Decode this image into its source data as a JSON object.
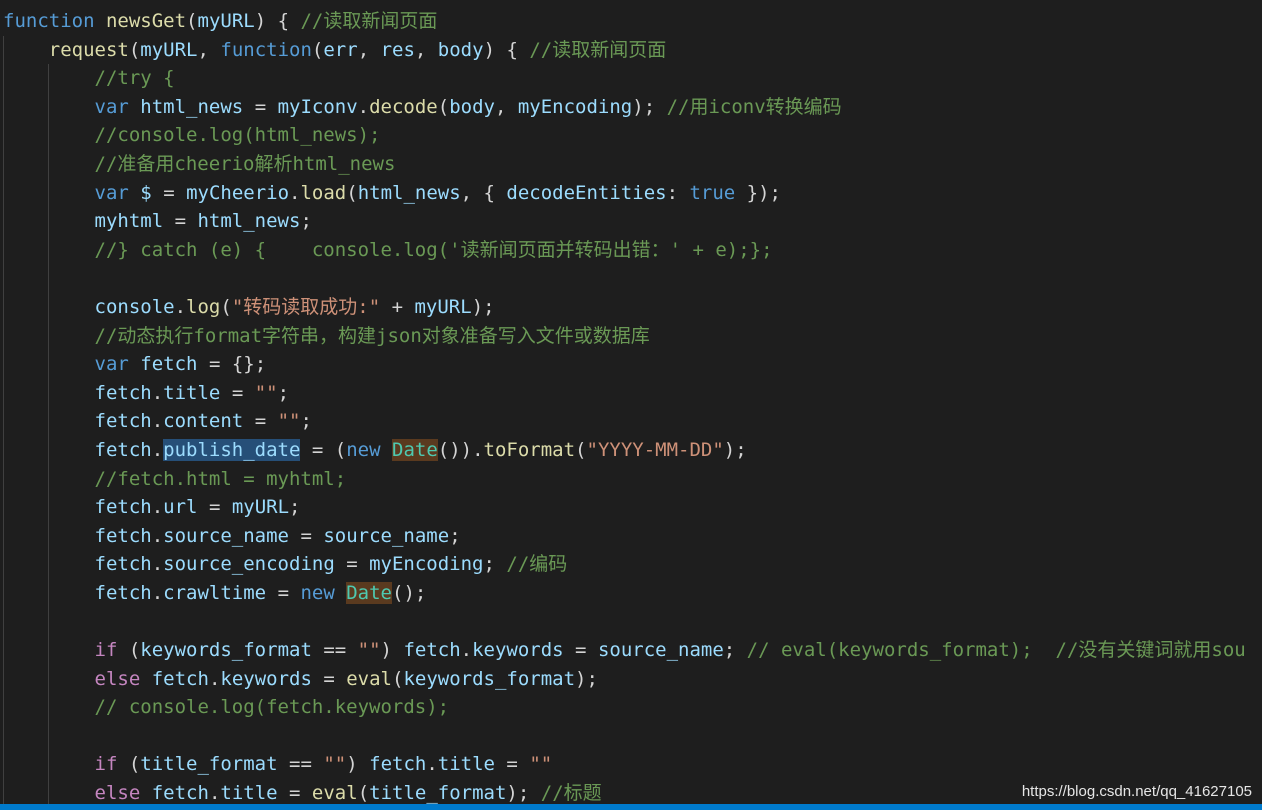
{
  "editor": {
    "lines": [
      [
        [
          "kw",
          "function"
        ],
        [
          "punc",
          " "
        ],
        [
          "fn",
          "newsGet"
        ],
        [
          "punc",
          "("
        ],
        [
          "var",
          "myURL"
        ],
        [
          "punc",
          ") { "
        ],
        [
          "cmt",
          "//读取新闻页面"
        ]
      ],
      [
        [
          "punc",
          "    "
        ],
        [
          "fn",
          "request"
        ],
        [
          "punc",
          "("
        ],
        [
          "var",
          "myURL"
        ],
        [
          "punc",
          ", "
        ],
        [
          "kw",
          "function"
        ],
        [
          "punc",
          "("
        ],
        [
          "var",
          "err"
        ],
        [
          "punc",
          ", "
        ],
        [
          "var",
          "res"
        ],
        [
          "punc",
          ", "
        ],
        [
          "var",
          "body"
        ],
        [
          "punc",
          ") { "
        ],
        [
          "cmt",
          "//读取新闻页面"
        ]
      ],
      [
        [
          "punc",
          "        "
        ],
        [
          "cmt",
          "//try {"
        ]
      ],
      [
        [
          "punc",
          "        "
        ],
        [
          "kw",
          "var"
        ],
        [
          "punc",
          " "
        ],
        [
          "var",
          "html_news"
        ],
        [
          "punc",
          " = "
        ],
        [
          "var",
          "myIconv"
        ],
        [
          "punc",
          "."
        ],
        [
          "fn",
          "decode"
        ],
        [
          "punc",
          "("
        ],
        [
          "var",
          "body"
        ],
        [
          "punc",
          ", "
        ],
        [
          "var",
          "myEncoding"
        ],
        [
          "punc",
          "); "
        ],
        [
          "cmt",
          "//用iconv转换编码"
        ]
      ],
      [
        [
          "punc",
          "        "
        ],
        [
          "cmt",
          "//console.log(html_news);"
        ]
      ],
      [
        [
          "punc",
          "        "
        ],
        [
          "cmt",
          "//准备用cheerio解析html_news"
        ]
      ],
      [
        [
          "punc",
          "        "
        ],
        [
          "kw",
          "var"
        ],
        [
          "punc",
          " "
        ],
        [
          "var",
          "$"
        ],
        [
          "punc",
          " = "
        ],
        [
          "var",
          "myCheerio"
        ],
        [
          "punc",
          "."
        ],
        [
          "fn",
          "load"
        ],
        [
          "punc",
          "("
        ],
        [
          "var",
          "html_news"
        ],
        [
          "punc",
          ", { "
        ],
        [
          "var",
          "decodeEntities"
        ],
        [
          "punc",
          ": "
        ],
        [
          "kw",
          "true"
        ],
        [
          "punc",
          " });"
        ]
      ],
      [
        [
          "punc",
          "        "
        ],
        [
          "var",
          "myhtml"
        ],
        [
          "punc",
          " = "
        ],
        [
          "var",
          "html_news"
        ],
        [
          "punc",
          ";"
        ]
      ],
      [
        [
          "punc",
          "        "
        ],
        [
          "cmt",
          "//} catch (e) {    console.log('读新闻页面并转码出错：' + e);};"
        ]
      ],
      [
        [
          "punc",
          " "
        ]
      ],
      [
        [
          "punc",
          "        "
        ],
        [
          "var",
          "console"
        ],
        [
          "punc",
          "."
        ],
        [
          "fn",
          "log"
        ],
        [
          "punc",
          "("
        ],
        [
          "str",
          "\"转码读取成功:\""
        ],
        [
          "punc",
          " + "
        ],
        [
          "var",
          "myURL"
        ],
        [
          "punc",
          ");"
        ]
      ],
      [
        [
          "punc",
          "        "
        ],
        [
          "cmt",
          "//动态执行format字符串，构建json对象准备写入文件或数据库"
        ]
      ],
      [
        [
          "punc",
          "        "
        ],
        [
          "kw",
          "var"
        ],
        [
          "punc",
          " "
        ],
        [
          "var",
          "fetch"
        ],
        [
          "punc",
          " = {};"
        ]
      ],
      [
        [
          "punc",
          "        "
        ],
        [
          "var",
          "fetch"
        ],
        [
          "punc",
          "."
        ],
        [
          "var",
          "title"
        ],
        [
          "punc",
          " = "
        ],
        [
          "str",
          "\"\""
        ],
        [
          "punc",
          ";"
        ]
      ],
      [
        [
          "punc",
          "        "
        ],
        [
          "var",
          "fetch"
        ],
        [
          "punc",
          "."
        ],
        [
          "var",
          "content"
        ],
        [
          "punc",
          " = "
        ],
        [
          "str",
          "\"\""
        ],
        [
          "punc",
          ";"
        ]
      ],
      [
        [
          "punc",
          "        "
        ],
        [
          "var",
          "fetch"
        ],
        [
          "punc",
          "."
        ],
        [
          "hl",
          "publish_date"
        ],
        [
          "punc",
          " = ("
        ],
        [
          "kw",
          "new"
        ],
        [
          "punc",
          " "
        ],
        [
          "bhl",
          "Date"
        ],
        [
          "punc",
          "())."
        ],
        [
          "fn",
          "toFormat"
        ],
        [
          "punc",
          "("
        ],
        [
          "str",
          "\"YYYY-MM-DD\""
        ],
        [
          "punc",
          ");"
        ]
      ],
      [
        [
          "punc",
          "        "
        ],
        [
          "cmt",
          "//fetch.html = myhtml;"
        ]
      ],
      [
        [
          "punc",
          "        "
        ],
        [
          "var",
          "fetch"
        ],
        [
          "punc",
          "."
        ],
        [
          "var",
          "url"
        ],
        [
          "punc",
          " = "
        ],
        [
          "var",
          "myURL"
        ],
        [
          "punc",
          ";"
        ]
      ],
      [
        [
          "punc",
          "        "
        ],
        [
          "var",
          "fetch"
        ],
        [
          "punc",
          "."
        ],
        [
          "var",
          "source_name"
        ],
        [
          "punc",
          " = "
        ],
        [
          "var",
          "source_name"
        ],
        [
          "punc",
          ";"
        ]
      ],
      [
        [
          "punc",
          "        "
        ],
        [
          "var",
          "fetch"
        ],
        [
          "punc",
          "."
        ],
        [
          "var",
          "source_encoding"
        ],
        [
          "punc",
          " = "
        ],
        [
          "var",
          "myEncoding"
        ],
        [
          "punc",
          "; "
        ],
        [
          "cmt",
          "//编码"
        ]
      ],
      [
        [
          "punc",
          "        "
        ],
        [
          "var",
          "fetch"
        ],
        [
          "punc",
          "."
        ],
        [
          "var",
          "crawltime"
        ],
        [
          "punc",
          " = "
        ],
        [
          "kw",
          "new"
        ],
        [
          "punc",
          " "
        ],
        [
          "bhl",
          "Date"
        ],
        [
          "punc",
          "();"
        ]
      ],
      [
        [
          "punc",
          " "
        ]
      ],
      [
        [
          "punc",
          "        "
        ],
        [
          "ctrl",
          "if"
        ],
        [
          "punc",
          " ("
        ],
        [
          "var",
          "keywords_format"
        ],
        [
          "punc",
          " == "
        ],
        [
          "str",
          "\"\""
        ],
        [
          "punc",
          ") "
        ],
        [
          "var",
          "fetch"
        ],
        [
          "punc",
          "."
        ],
        [
          "var",
          "keywords"
        ],
        [
          "punc",
          " = "
        ],
        [
          "var",
          "source_name"
        ],
        [
          "punc",
          "; "
        ],
        [
          "cmt",
          "// eval(keywords_format);  //没有关键词就用sou"
        ]
      ],
      [
        [
          "punc",
          "        "
        ],
        [
          "ctrl",
          "else"
        ],
        [
          "punc",
          " "
        ],
        [
          "var",
          "fetch"
        ],
        [
          "punc",
          "."
        ],
        [
          "var",
          "keywords"
        ],
        [
          "punc",
          " = "
        ],
        [
          "fn",
          "eval"
        ],
        [
          "punc",
          "("
        ],
        [
          "var",
          "keywords_format"
        ],
        [
          "punc",
          ");"
        ]
      ],
      [
        [
          "punc",
          "        "
        ],
        [
          "cmt",
          "// console.log(fetch.keywords);"
        ]
      ],
      [
        [
          "punc",
          " "
        ]
      ],
      [
        [
          "punc",
          "        "
        ],
        [
          "ctrl",
          "if"
        ],
        [
          "punc",
          " ("
        ],
        [
          "var",
          "title_format"
        ],
        [
          "punc",
          " == "
        ],
        [
          "str",
          "\"\""
        ],
        [
          "punc",
          ") "
        ],
        [
          "var",
          "fetch"
        ],
        [
          "punc",
          "."
        ],
        [
          "var",
          "title"
        ],
        [
          "punc",
          " = "
        ],
        [
          "str",
          "\"\""
        ]
      ],
      [
        [
          "punc",
          "        "
        ],
        [
          "ctrl",
          "else"
        ],
        [
          "punc",
          " "
        ],
        [
          "var",
          "fetch"
        ],
        [
          "punc",
          "."
        ],
        [
          "var",
          "title"
        ],
        [
          "punc",
          " = "
        ],
        [
          "fn",
          "eval"
        ],
        [
          "punc",
          "("
        ],
        [
          "var",
          "title_format"
        ],
        [
          "punc",
          "); "
        ],
        [
          "cmt",
          "//标题"
        ]
      ]
    ]
  },
  "watermark": {
    "text": "https://blog.csdn.net/qq_41627105"
  },
  "colors": {
    "background": "#1e1e1e",
    "keyword": "#569cd6",
    "function": "#dcdcaa",
    "variable": "#9cdcfe",
    "string": "#ce9178",
    "comment": "#6a9955",
    "statusbar": "#007acc"
  }
}
